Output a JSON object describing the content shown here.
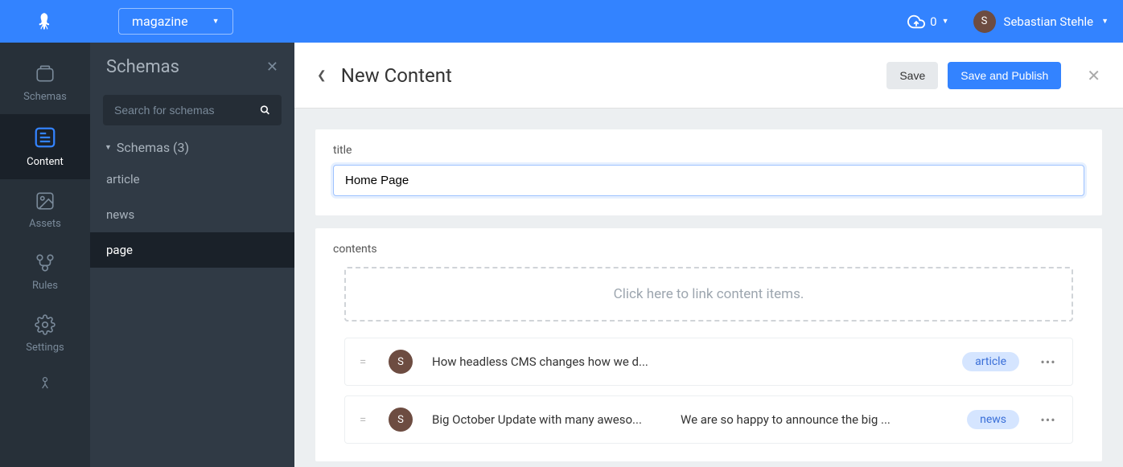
{
  "topbar": {
    "app_name": "magazine",
    "cloud_count": "0",
    "user_initial": "S",
    "user_name": "Sebastian Stehle"
  },
  "iconnav": {
    "items": [
      {
        "label": "Schemas"
      },
      {
        "label": "Content"
      },
      {
        "label": "Assets"
      },
      {
        "label": "Rules"
      },
      {
        "label": "Settings"
      }
    ]
  },
  "schemas_panel": {
    "title": "Schemas",
    "search_placeholder": "Search for schemas",
    "group_label": "Schemas (3)",
    "items": [
      {
        "label": "article"
      },
      {
        "label": "news"
      },
      {
        "label": "page"
      }
    ]
  },
  "content": {
    "page_title": "New Content",
    "save_label": "Save",
    "publish_label": "Save and Publish",
    "fields": {
      "title_label": "title",
      "title_value": "Home Page",
      "contents_label": "contents",
      "link_placeholder": "Click here to link content items."
    },
    "linked": [
      {
        "avatar": "S",
        "title": "How headless CMS changes how we d...",
        "desc": "",
        "tag": "article"
      },
      {
        "avatar": "S",
        "title": "Big October Update with many aweso...",
        "desc": "We are so happy to announce the big ...",
        "tag": "news"
      }
    ]
  }
}
